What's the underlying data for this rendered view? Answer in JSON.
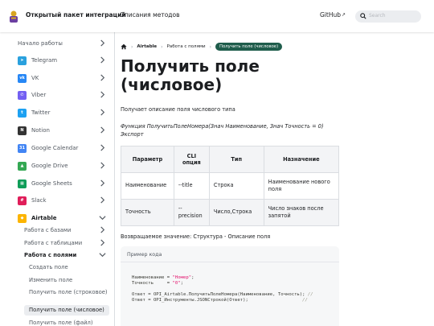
{
  "navbar": {
    "brand": "Открытый пакет интеграций",
    "methods_link": "Описания методов",
    "github": "GitHub",
    "search_placeholder": "Search"
  },
  "sidebar": {
    "top": "Начало работы",
    "items": [
      {
        "label": "Telegram",
        "color": "#2aa1de",
        "glyph": "➤"
      },
      {
        "label": "VK",
        "color": "#2787f5",
        "glyph": "vk"
      },
      {
        "label": "Viber",
        "color": "#7360f2",
        "glyph": "✆"
      },
      {
        "label": "Twitter",
        "color": "#1da1f2",
        "glyph": "t"
      },
      {
        "label": "Notion",
        "color": "#333333",
        "glyph": "N"
      },
      {
        "label": "Google Calendar",
        "color": "#4285f4",
        "glyph": "31"
      },
      {
        "label": "Google Drive",
        "color": "#34a853",
        "glyph": "▲"
      },
      {
        "label": "Google Sheets",
        "color": "#0f9d58",
        "glyph": "▦"
      },
      {
        "label": "Slack",
        "color": "#e01e5a",
        "glyph": "#"
      },
      {
        "label": "Airtable",
        "color": "#fcb400",
        "glyph": "◆"
      }
    ],
    "sub": [
      "Работа с базами",
      "Работа с таблицами",
      "Работа с полями"
    ],
    "leaves": [
      "Создать поле",
      "Изменить поле",
      "Получить поле (строковое)",
      "Получить поле (числовое)",
      "Получить поле (файл)"
    ]
  },
  "breadcrumb": {
    "level1": "Airtable",
    "level2": "Работа с полями",
    "current": "Получить поле (числовое)"
  },
  "page": {
    "title": "Получить поле (числовое)",
    "description": "Получает описание поля числового типа",
    "signature": "Функция ПолучитьПолеНомера(Знач Наименование, Знач Точность = 0) Экспорт",
    "returns": "Возвращаемое значение: Структура - Описание поля"
  },
  "table": {
    "headers": [
      "Параметр",
      "CLI опция",
      "Тип",
      "Назначение"
    ],
    "rows": [
      [
        "Наименование",
        "--title",
        "Строка",
        "Наименование нового поля"
      ],
      [
        "Точность",
        "--precision",
        "Число,Строка",
        "Число знаков после запятой"
      ]
    ]
  },
  "code": {
    "title": "Пример кода",
    "l1_a": "Наименование = ",
    "l1_b": "\"Номер\"",
    "l1_c": ";",
    "l2_a": "Точность     = ",
    "l2_b": "\"0\"",
    "l2_c": ";",
    "l3": "Ответ = OPI_Airtable.ПолучитьПолеНомера(Наименование, Точность); ",
    "l3_cmt": "//",
    "l4": "Ответ = OPI_Инструменты.JSONСтрокой(Ответ);                    ",
    "l4_cmt": "//"
  }
}
